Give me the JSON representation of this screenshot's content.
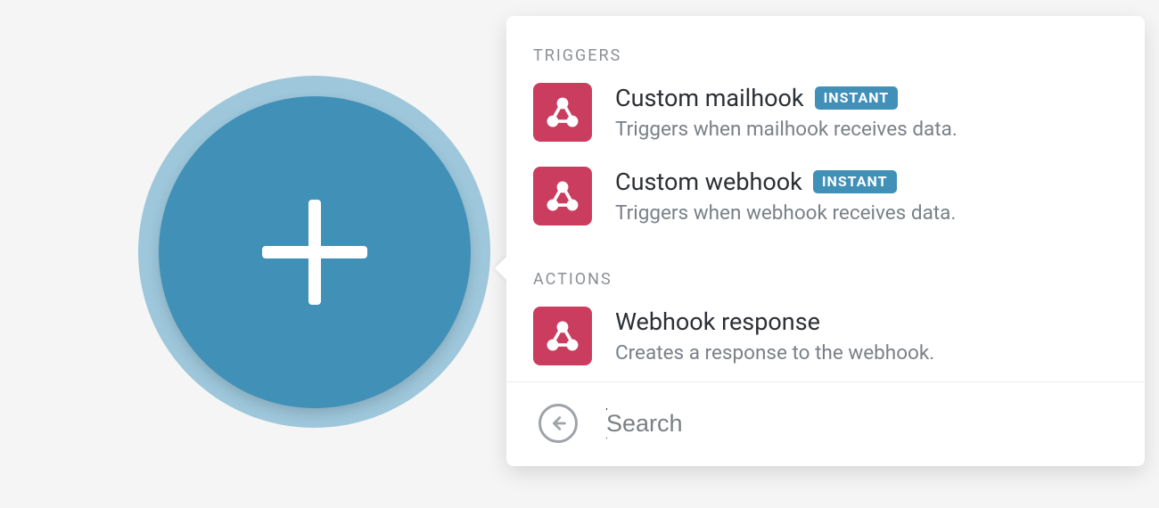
{
  "colors": {
    "accent": "#4190b8",
    "accentLight": "#9ec7db",
    "iconBg": "#cb3d5e"
  },
  "sections": {
    "triggers": {
      "header": "TRIGGERS",
      "items": [
        {
          "title": "Custom mailhook",
          "badge": "INSTANT",
          "desc": "Triggers when mailhook receives data."
        },
        {
          "title": "Custom webhook",
          "badge": "INSTANT",
          "desc": "Triggers when webhook receives data."
        }
      ]
    },
    "actions": {
      "header": "ACTIONS",
      "items": [
        {
          "title": "Webhook response",
          "desc": "Creates a response to the webhook."
        }
      ]
    }
  },
  "search": {
    "placeholder": "Search",
    "value": ""
  }
}
